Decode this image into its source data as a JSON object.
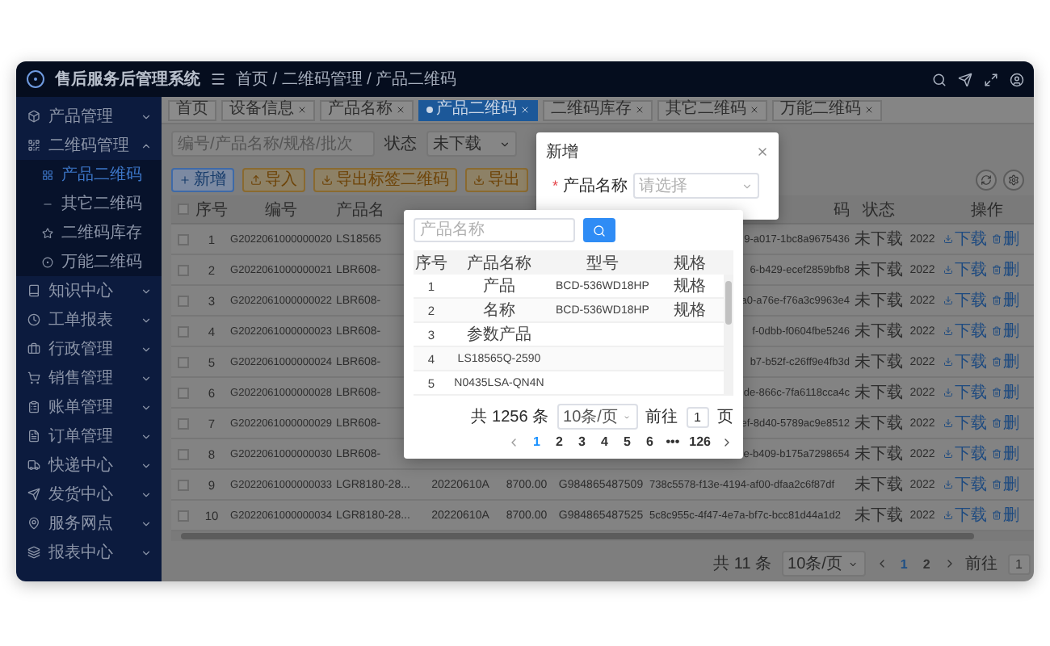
{
  "app": {
    "title": "售后服务后管理系统",
    "breadcrumb": "首页 / 二维码管理 / 产品二维码"
  },
  "sidebar": {
    "items": [
      {
        "label": "产品管理",
        "expanded": false
      },
      {
        "label": "二维码管理",
        "expanded": true,
        "children": [
          {
            "label": "产品二维码",
            "selected": true
          },
          {
            "label": "其它二维码",
            "selected": false
          },
          {
            "label": "二维码库存",
            "selected": false
          },
          {
            "label": "万能二维码",
            "selected": false
          }
        ]
      },
      {
        "label": "知识中心",
        "expanded": false
      },
      {
        "label": "工单报表",
        "expanded": false
      },
      {
        "label": "行政管理",
        "expanded": false
      },
      {
        "label": "销售管理",
        "expanded": false
      },
      {
        "label": "账单管理",
        "expanded": false
      },
      {
        "label": "订单管理",
        "expanded": false
      },
      {
        "label": "快递中心",
        "expanded": false
      },
      {
        "label": "发货中心",
        "expanded": false
      },
      {
        "label": "服务网点",
        "expanded": false
      },
      {
        "label": "报表中心",
        "expanded": false
      }
    ]
  },
  "tabs": [
    {
      "label": "首页",
      "selected": false,
      "closable": false
    },
    {
      "label": "设备信息",
      "selected": false,
      "closable": true
    },
    {
      "label": "产品名称",
      "selected": false,
      "closable": true
    },
    {
      "label": "产品二维码",
      "selected": true,
      "closable": true
    },
    {
      "label": "二维码库存",
      "selected": false,
      "closable": true
    },
    {
      "label": "其它二维码",
      "selected": false,
      "closable": true
    },
    {
      "label": "万能二维码",
      "selected": false,
      "closable": true
    }
  ],
  "toolbar": {
    "search": {
      "placeholder": "编号/产品名称/规格/批次"
    },
    "status_label": "状态",
    "status_value": "未下载",
    "buttons": [
      {
        "label": "新增",
        "kind": "primary"
      },
      {
        "label": "导入",
        "kind": "warning"
      },
      {
        "label": "导出标签二维码",
        "kind": "warning"
      },
      {
        "label": "导出",
        "kind": "warning"
      }
    ]
  },
  "table": {
    "all_checked": false,
    "header": {
      "no": "序号",
      "code": "编号",
      "product": "产品名",
      "qr": "码",
      "status": "状态",
      "action": "操作"
    },
    "rows": [
      {
        "checked": false,
        "no": "1",
        "code": "G2022061000000020",
        "product": "LS18565",
        "qr": "9-a017-1bc8a9675436",
        "status": "未下载",
        "year": "2022",
        "actions": [
          {
            "kind": "download",
            "label": "下载"
          },
          {
            "kind": "delete",
            "label": "删"
          }
        ]
      },
      {
        "checked": false,
        "no": "2",
        "code": "G2022061000000021",
        "product": "LBR608-",
        "qr": "6-b429-ecef2859bfb8",
        "status": "未下载",
        "year": "2022",
        "actions": [
          {
            "kind": "download",
            "label": "下载"
          },
          {
            "kind": "delete",
            "label": "删"
          }
        ]
      },
      {
        "checked": false,
        "no": "3",
        "code": "G2022061000000022",
        "product": "LBR608-",
        "qr": "a0-a76e-f76a3c9963e4",
        "status": "未下载",
        "year": "2022",
        "actions": [
          {
            "kind": "download",
            "label": "下载"
          },
          {
            "kind": "delete",
            "label": "删"
          }
        ]
      },
      {
        "checked": false,
        "no": "4",
        "code": "G2022061000000023",
        "product": "LBR608-",
        "qr": "f-0dbb-f0604fbe5246",
        "status": "未下载",
        "year": "2022",
        "actions": [
          {
            "kind": "download",
            "label": "下载"
          },
          {
            "kind": "delete",
            "label": "删"
          }
        ]
      },
      {
        "checked": false,
        "no": "5",
        "code": "G2022061000000024",
        "product": "LBR608-",
        "qr": "b7-b52f-c26ff9e4fb3d",
        "status": "未下载",
        "year": "2022",
        "actions": [
          {
            "kind": "download",
            "label": "下载"
          },
          {
            "kind": "delete",
            "label": "删"
          }
        ]
      },
      {
        "checked": false,
        "no": "6",
        "code": "G2022061000000028",
        "product": "LBR608-",
        "qr": "de-866c-7fa6118cca4c",
        "status": "未下载",
        "year": "2022",
        "actions": [
          {
            "kind": "download",
            "label": "下载"
          },
          {
            "kind": "delete",
            "label": "删"
          }
        ]
      },
      {
        "checked": false,
        "no": "7",
        "code": "G2022061000000029",
        "product": "LBR608-",
        "qr": "ef-8d40-5789ac9e8512",
        "status": "未下载",
        "year": "2022",
        "actions": [
          {
            "kind": "download",
            "label": "下载"
          },
          {
            "kind": "delete",
            "label": "删"
          }
        ]
      },
      {
        "checked": false,
        "no": "8",
        "code": "G2022061000000030",
        "product": "LBR608-",
        "qr": "e-b409-b175a7298654",
        "status": "未下载",
        "year": "2022",
        "actions": [
          {
            "kind": "download",
            "label": "下载"
          },
          {
            "kind": "delete",
            "label": "删"
          }
        ]
      },
      {
        "checked": false,
        "no": "9",
        "code": "G2022061000000033",
        "product": "LGR8180-28...",
        "batch": "20220610A",
        "price": "8700.00",
        "code2": "G984865487509",
        "qr": "738c5578-f13e-4194-af00-dfaa2c6f87df",
        "status": "未下载",
        "year": "2022",
        "actions": [
          {
            "kind": "download",
            "label": "下载"
          },
          {
            "kind": "delete",
            "label": "删"
          }
        ]
      },
      {
        "checked": false,
        "no": "10",
        "code": "G2022061000000034",
        "product": "LGR8180-28...",
        "batch": "20220610A",
        "price": "8700.00",
        "code2": "G984865487525",
        "qr": "5c8c955c-4f47-4e7a-bf7c-bcc81d44a1d2",
        "status": "未下载",
        "year": "2022",
        "actions": [
          {
            "kind": "download",
            "label": "下载"
          },
          {
            "kind": "delete",
            "label": "删"
          }
        ]
      }
    ]
  },
  "pagination": {
    "total": "共 11 条",
    "page_size": "10条/页",
    "pages": [
      {
        "label": "1",
        "selected": true
      },
      {
        "label": "2",
        "selected": false
      }
    ],
    "goto_label": "前往",
    "goto_value": "1"
  },
  "dialog": {
    "title": "新增",
    "field": {
      "required_mark": "*",
      "label": "产品名称",
      "placeholder": "请选择"
    }
  },
  "picker": {
    "search": {
      "placeholder": "产品名称"
    },
    "columns": [
      "序号",
      "产品名称",
      "型号",
      "规格"
    ],
    "rows": [
      {
        "no": "1",
        "name": "产品",
        "model": "BCD-536WD18HP",
        "spec": "规格"
      },
      {
        "no": "2",
        "name": "名称",
        "model": "BCD-536WD18HP",
        "spec": "规格"
      },
      {
        "no": "3",
        "name": "参数产品"
      },
      {
        "no": "4",
        "name": "LS18565Q-2590"
      },
      {
        "no": "5",
        "name": "N0435LSA-QN4N"
      }
    ],
    "pagination": {
      "total": "共 1256 条",
      "page_size": "10条/页",
      "pages": [
        {
          "label": "1",
          "selected": true
        },
        {
          "label": "2",
          "selected": false
        },
        {
          "label": "3",
          "selected": false
        },
        {
          "label": "4",
          "selected": false
        },
        {
          "label": "5",
          "selected": false
        },
        {
          "label": "6",
          "selected": false
        },
        {
          "label": "•••",
          "selected": false
        },
        {
          "label": "126",
          "selected": false
        }
      ],
      "goto_label": "前往",
      "goto_value": "1",
      "goto_suffix": "页"
    }
  }
}
